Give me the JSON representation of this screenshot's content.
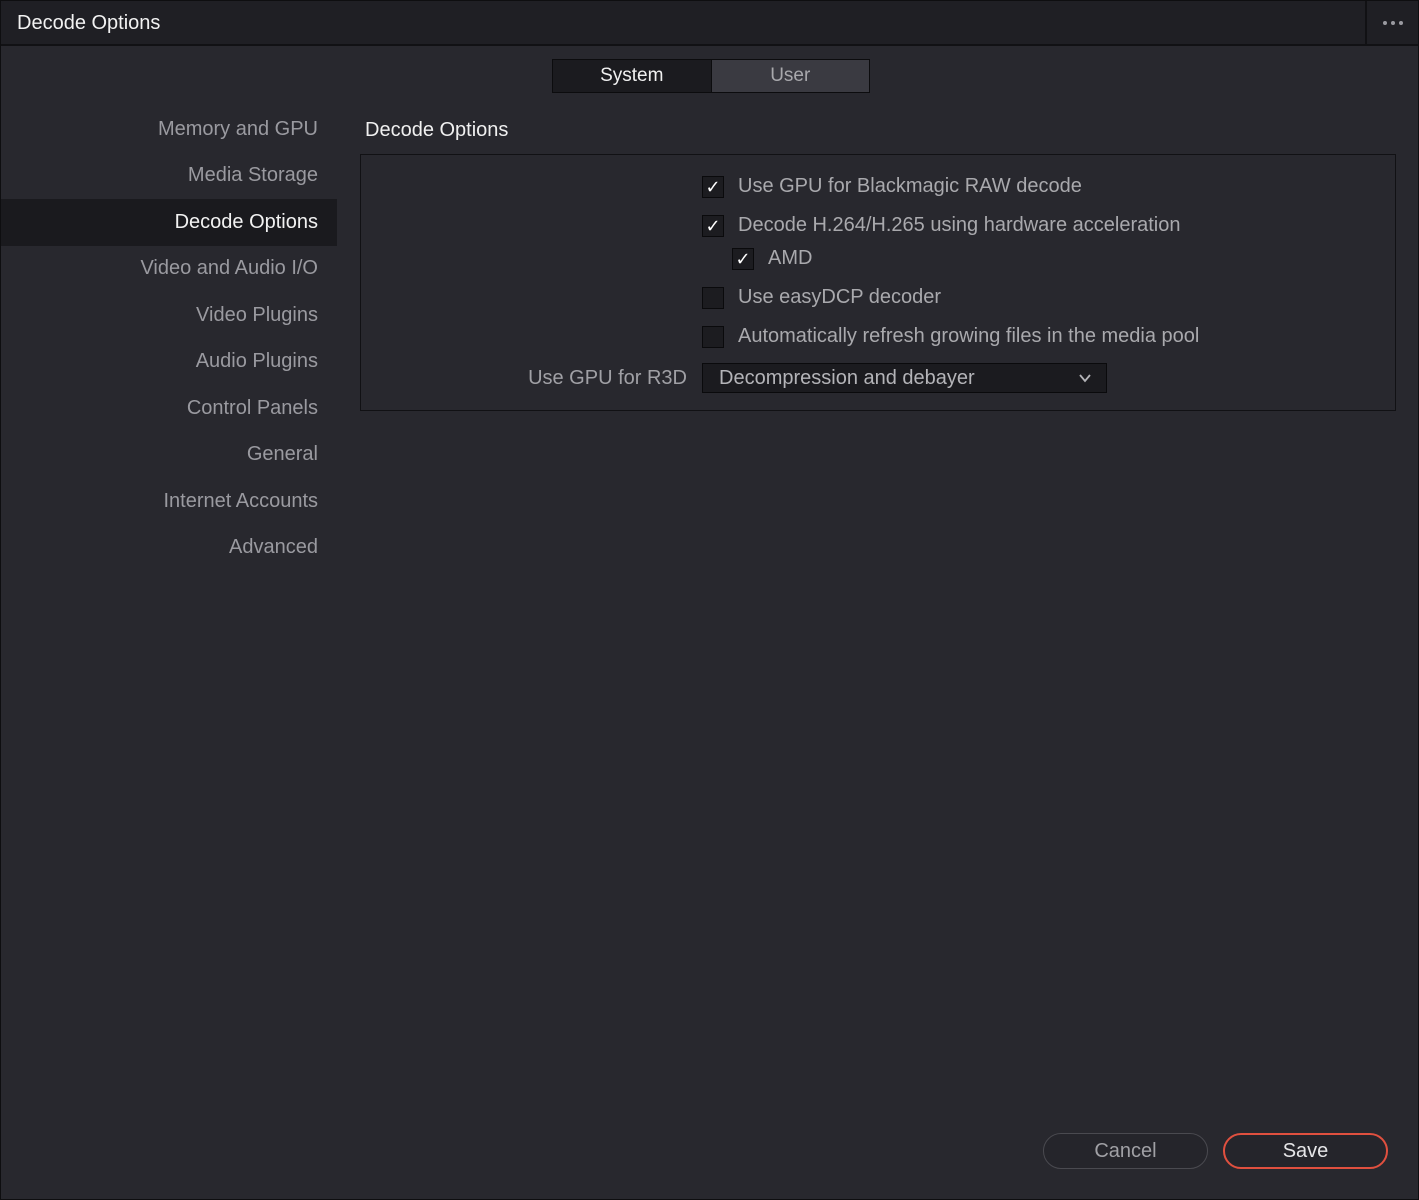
{
  "window": {
    "title": "Decode Options"
  },
  "tabs": [
    {
      "label": "System",
      "active": true
    },
    {
      "label": "User",
      "active": false
    }
  ],
  "sidebar": {
    "items": [
      {
        "label": "Memory and GPU"
      },
      {
        "label": "Media Storage"
      },
      {
        "label": "Decode Options",
        "active": true
      },
      {
        "label": "Video and Audio I/O"
      },
      {
        "label": "Video Plugins"
      },
      {
        "label": "Audio Plugins"
      },
      {
        "label": "Control Panels"
      },
      {
        "label": "General"
      },
      {
        "label": "Internet Accounts"
      },
      {
        "label": "Advanced"
      }
    ]
  },
  "section": {
    "title": "Decode Options",
    "options": [
      {
        "label": "Use GPU for Blackmagic RAW decode",
        "checked": true,
        "check_glyph": "✓"
      },
      {
        "label": "Decode H.264/H.265 using hardware acceleration",
        "checked": true,
        "check_glyph": "✓"
      },
      {
        "label": "AMD",
        "checked": true,
        "check_glyph": "✓"
      },
      {
        "label": "Use easyDCP decoder",
        "checked": false,
        "check_glyph": ""
      },
      {
        "label": "Automatically refresh growing files in the media pool",
        "checked": false,
        "check_glyph": ""
      }
    ],
    "r3d": {
      "label": "Use GPU for R3D",
      "value": "Decompression and debayer"
    }
  },
  "footer": {
    "cancel_label": "Cancel",
    "save_label": "Save"
  },
  "colors": {
    "accent": "#e0503f",
    "background": "#28282e"
  },
  "icons": {
    "more": "more-horizontal-icon",
    "dropdown": "chevron-down-icon",
    "check": "check-icon"
  }
}
